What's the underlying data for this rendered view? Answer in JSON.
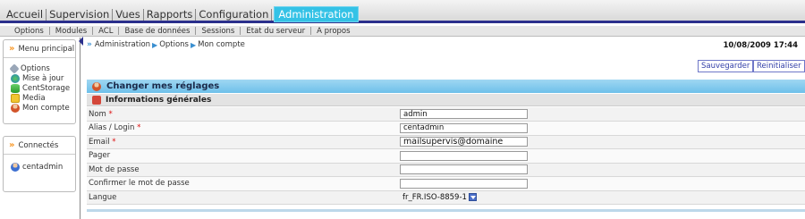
{
  "topnav": {
    "tabs": [
      {
        "label": "Accueil"
      },
      {
        "label": "Supervision"
      },
      {
        "label": "Vues"
      },
      {
        "label": "Rapports"
      },
      {
        "label": "Configuration"
      },
      {
        "label": "Administration"
      }
    ],
    "active": "Administration",
    "accent": "#34c2e6",
    "bar_color": "#2b2f8c"
  },
  "subnav": {
    "items": [
      "Options",
      "Modules",
      "ACL",
      "Base de données",
      "Sessions",
      "Etat du serveur",
      "A propos"
    ]
  },
  "sidebar": {
    "menu_title": "Menu principal",
    "items": [
      {
        "label": "Options",
        "icon": "wrench-icon"
      },
      {
        "label": "Mise à jour",
        "icon": "globe-icon"
      },
      {
        "label": "CentStorage",
        "icon": "database-icon"
      },
      {
        "label": "Media",
        "icon": "folder-icon"
      },
      {
        "label": "Mon compte",
        "icon": "user-icon"
      }
    ],
    "connected_title": "Connectés",
    "connected_user": "centadmin"
  },
  "breadcrumb": [
    "Administration",
    "Options",
    "Mon compte"
  ],
  "datetime": "10/08/2009 17:44",
  "buttons": {
    "save": "Sauvegarder",
    "reset": "Reinitialiser"
  },
  "panel_title": "Changer mes réglages",
  "section_title": "Informations générales",
  "form": {
    "rows": [
      {
        "label": "Nom",
        "required": "*",
        "value": "admin"
      },
      {
        "label": "Alias / Login",
        "required": "*",
        "value": "centadmin"
      },
      {
        "label": "Email",
        "required": "*",
        "value": "mailsupervis@domaine"
      },
      {
        "label": "Pager",
        "required": "",
        "value": ""
      },
      {
        "label": "Mot de passe",
        "required": "",
        "value": ""
      },
      {
        "label": "Confirmer le mot de passe",
        "required": "",
        "value": ""
      },
      {
        "label": "Langue",
        "required": "",
        "value": "fr_FR.ISO-8859-1"
      }
    ]
  }
}
